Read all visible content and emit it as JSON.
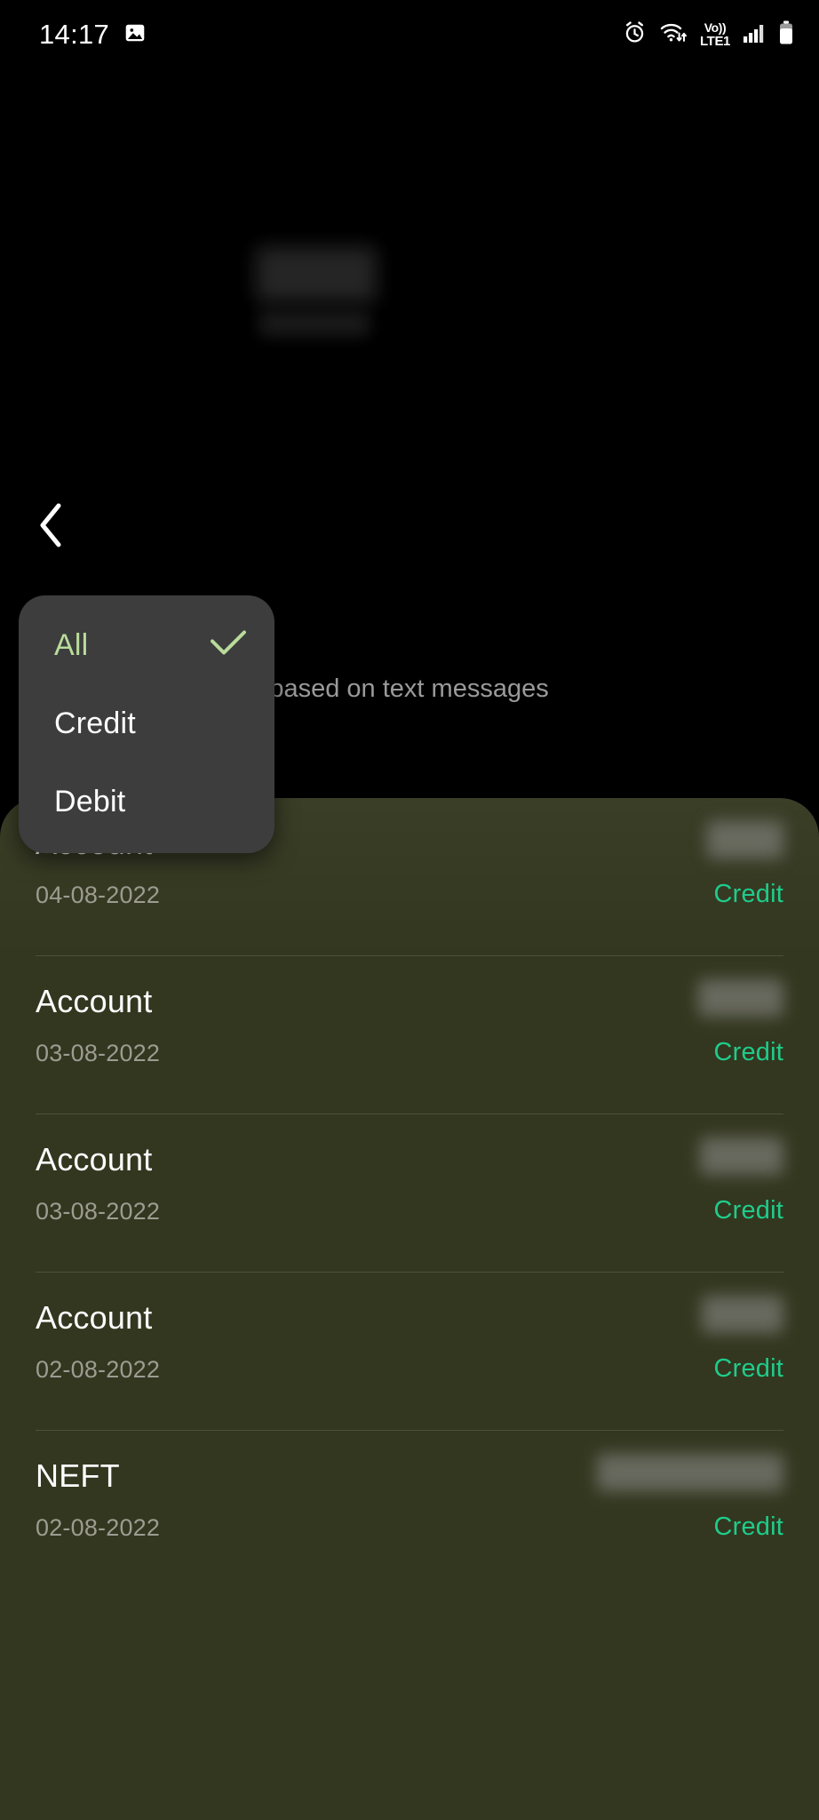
{
  "status_bar": {
    "time": "14:17",
    "left_icons": [
      "image-icon"
    ],
    "right_icons": [
      "alarm-icon",
      "wifi-transfer-icon",
      "volte-icon",
      "signal-bars-icon",
      "battery-icon"
    ],
    "volte_top": "Vo))",
    "volte_bottom": "LTE1"
  },
  "nav": {
    "back_icon": "chevron-left-icon"
  },
  "page": {
    "subtitle": "This information is based on text messages"
  },
  "filter_menu": {
    "items": [
      {
        "label": "All",
        "selected": true,
        "check_icon": "check-icon"
      },
      {
        "label": "Credit",
        "selected": false
      },
      {
        "label": "Debit",
        "selected": false
      }
    ]
  },
  "transactions": {
    "rows": [
      {
        "title": "Account",
        "date": "04-08-2022",
        "type": "Credit",
        "amount": ""
      },
      {
        "title": "Account",
        "date": "03-08-2022",
        "type": "Credit",
        "amount": ""
      },
      {
        "title": "Account",
        "date": "03-08-2022",
        "type": "Credit",
        "amount": ""
      },
      {
        "title": "Account",
        "date": "02-08-2022",
        "type": "Credit",
        "amount": ""
      },
      {
        "title": "NEFT",
        "date": "02-08-2022",
        "type": "Credit",
        "amount": ""
      }
    ]
  },
  "colors": {
    "background": "#000000",
    "card": "#33371f",
    "menu": "#3d3d3d",
    "credit_green": "#1fcc8c",
    "selected_green": "#b9dc9b",
    "muted_text": "#9c9c92"
  }
}
